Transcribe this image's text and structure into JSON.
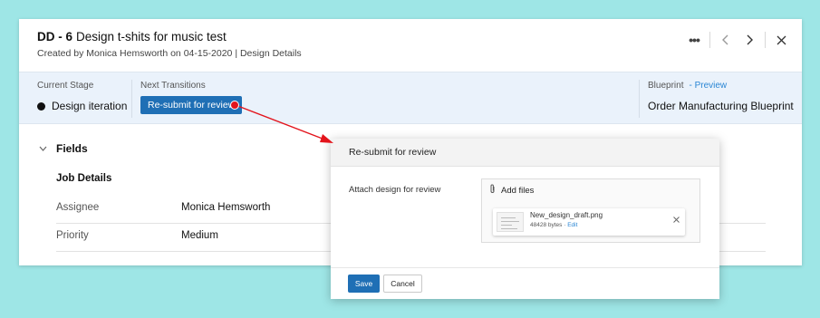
{
  "record": {
    "id": "DD - 6",
    "title": "Design t-shits for music test",
    "created_prefix": "Created by",
    "created_by": "Monica Hemsworth",
    "created_on": "on 04-15-2020",
    "layout": "| Design Details"
  },
  "header_icons": [
    "more-options-icon",
    "chevron-left-icon",
    "chevron-right-icon",
    "close-icon"
  ],
  "stage": {
    "current_label": "Current Stage",
    "current_value": "Design iteration",
    "next_label": "Next Transitions",
    "transition_button": "Re-submit for review",
    "blueprint_label": "Blueprint",
    "preview_link": "- Preview",
    "blueprint_value": "Order Manufacturing Blueprint"
  },
  "fields": {
    "toggle_label": "Fields",
    "section_title": "Job Details",
    "rows": [
      {
        "label": "Assignee",
        "value": "Monica Hemsworth"
      },
      {
        "label": "Priority",
        "value": "Medium"
      }
    ]
  },
  "dialog": {
    "title": "Re-submit for review",
    "attach_label": "Attach design for review",
    "add_files": "Add files",
    "file": {
      "name": "New_design_draft.png",
      "size": "48428 bytes",
      "edit": "Edit",
      "separator": "·"
    },
    "save": "Save",
    "cancel": "Cancel"
  },
  "colors": {
    "background": "#9ee6e6",
    "accent": "#1f6fb5",
    "link": "#2a86d4",
    "stage_bar": "#eaf2fb",
    "annotation_arrow": "#e3141c"
  }
}
